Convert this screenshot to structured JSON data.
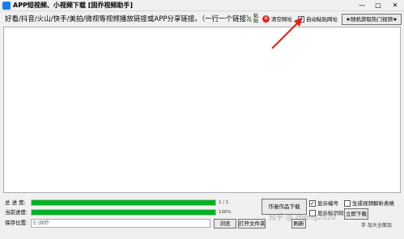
{
  "window": {
    "title": "APP短视频、小视频下载 [固乔视频助手]",
    "min_glyph": "—",
    "max_glyph": "□",
    "close_glyph": "✕"
  },
  "toolbar": {
    "url_label": "好看/抖音/火山/快手/美拍/微视等视频播放链接或APP分享链接。（一行一个链接）",
    "paste_label": "粘贴",
    "clear_label": "清空网址",
    "auto_paste_label": "自动粘贴网址",
    "auto_paste_checked": true,
    "random_label": "★随机获取热门视频★"
  },
  "main": {
    "urls_text": ""
  },
  "progress": {
    "total_label": "总 进 度:",
    "total_value": "1 / 1",
    "total_fraction": 1.0,
    "current_label": "当前进度:",
    "current_value": "100%",
    "current_fraction": 1.0,
    "save_label": "保存位置:",
    "save_path": "E:\\固乔",
    "browse_label": "浏览",
    "open_folder_label": "打开文件夹",
    "refresh_label": "刷新"
  },
  "options": {
    "author_download_label": "作者作品下载",
    "show_number_label": "显示编号",
    "show_number_checked": true,
    "show_tag_label": "显示标识码",
    "show_tag_checked": false,
    "generate_table_label": "生成视频解析表格",
    "generate_table_checked": false,
    "download_now_label": "立即下载",
    "corner_text": "手 加大全面加"
  },
  "overlay": {
    "watermark": "知乎 @ zheng2020",
    "arrow_color": "#d9261c"
  },
  "colors": {
    "progress_fill": "#06b025",
    "clear_icon": "#d9261c",
    "title_icon": "#1e7be1"
  }
}
